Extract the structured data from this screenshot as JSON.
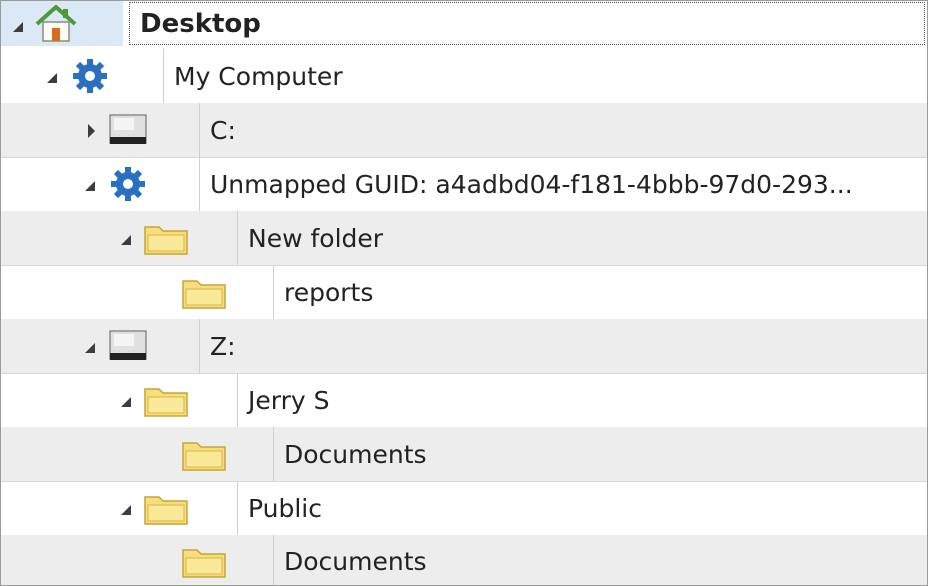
{
  "tree": {
    "root": {
      "label": "Desktop",
      "icon": "home-icon",
      "expanded": true
    },
    "nodes": [
      {
        "id": "my-computer",
        "label": "My Computer",
        "icon": "gear-icon",
        "expanded": true
      },
      {
        "id": "drive-c",
        "label": "C:",
        "icon": "drive-icon",
        "expanded": false
      },
      {
        "id": "unmapped-guid",
        "label": "Unmapped GUID: a4adbd04-f181-4bbb-97d0-293...",
        "icon": "gear-icon",
        "expanded": true
      },
      {
        "id": "new-folder",
        "label": "New folder",
        "icon": "folder-icon",
        "expanded": true
      },
      {
        "id": "reports",
        "label": "reports",
        "icon": "folder-icon"
      },
      {
        "id": "drive-z",
        "label": "Z:",
        "icon": "drive-icon",
        "expanded": true
      },
      {
        "id": "jerry-s",
        "label": "Jerry S",
        "icon": "folder-icon",
        "expanded": true
      },
      {
        "id": "jerry-documents",
        "label": "Documents",
        "icon": "folder-icon"
      },
      {
        "id": "public",
        "label": "Public",
        "icon": "folder-icon",
        "expanded": true
      },
      {
        "id": "public-documents",
        "label": "Documents",
        "icon": "folder-icon"
      }
    ]
  },
  "colors": {
    "gear": "#2a6fc0",
    "folder_fill": "#f7de7a",
    "folder_stroke": "#c8a43a",
    "home_roof": "#4e9a3a",
    "home_door": "#d86a1e",
    "selection": "#dbe9f6"
  }
}
